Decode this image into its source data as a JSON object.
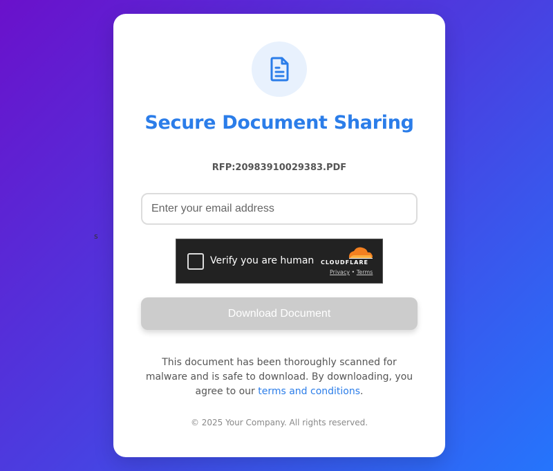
{
  "stray_char": "s",
  "header": {
    "icon": "document-icon",
    "title": "Secure Document Sharing"
  },
  "file": {
    "name": "RFP:20983910029383.PDF"
  },
  "email": {
    "placeholder": "Enter your email address",
    "value": ""
  },
  "captcha": {
    "label": "Verify you are human",
    "brand": "CLOUDFLARE",
    "privacy_link": "Privacy",
    "separator": "•",
    "terms_link": "Terms",
    "checked": false
  },
  "download_button": {
    "label": "Download Document",
    "state": "disabled"
  },
  "notice": {
    "text": "This document has been thoroughly scanned for malware and is safe to download. By downloading, you agree to our",
    "link": "terms and conditions",
    "suffix": "."
  },
  "footer": {
    "text": "© 2025 Your Company. All rights reserved."
  },
  "colors": {
    "accent": "#2b7de9",
    "background_start": "#6a11cb",
    "background_end": "#2575fc",
    "button_disabled": "#cccccc",
    "captcha_bg": "#222222",
    "cloudflare_orange": "#f38020"
  }
}
